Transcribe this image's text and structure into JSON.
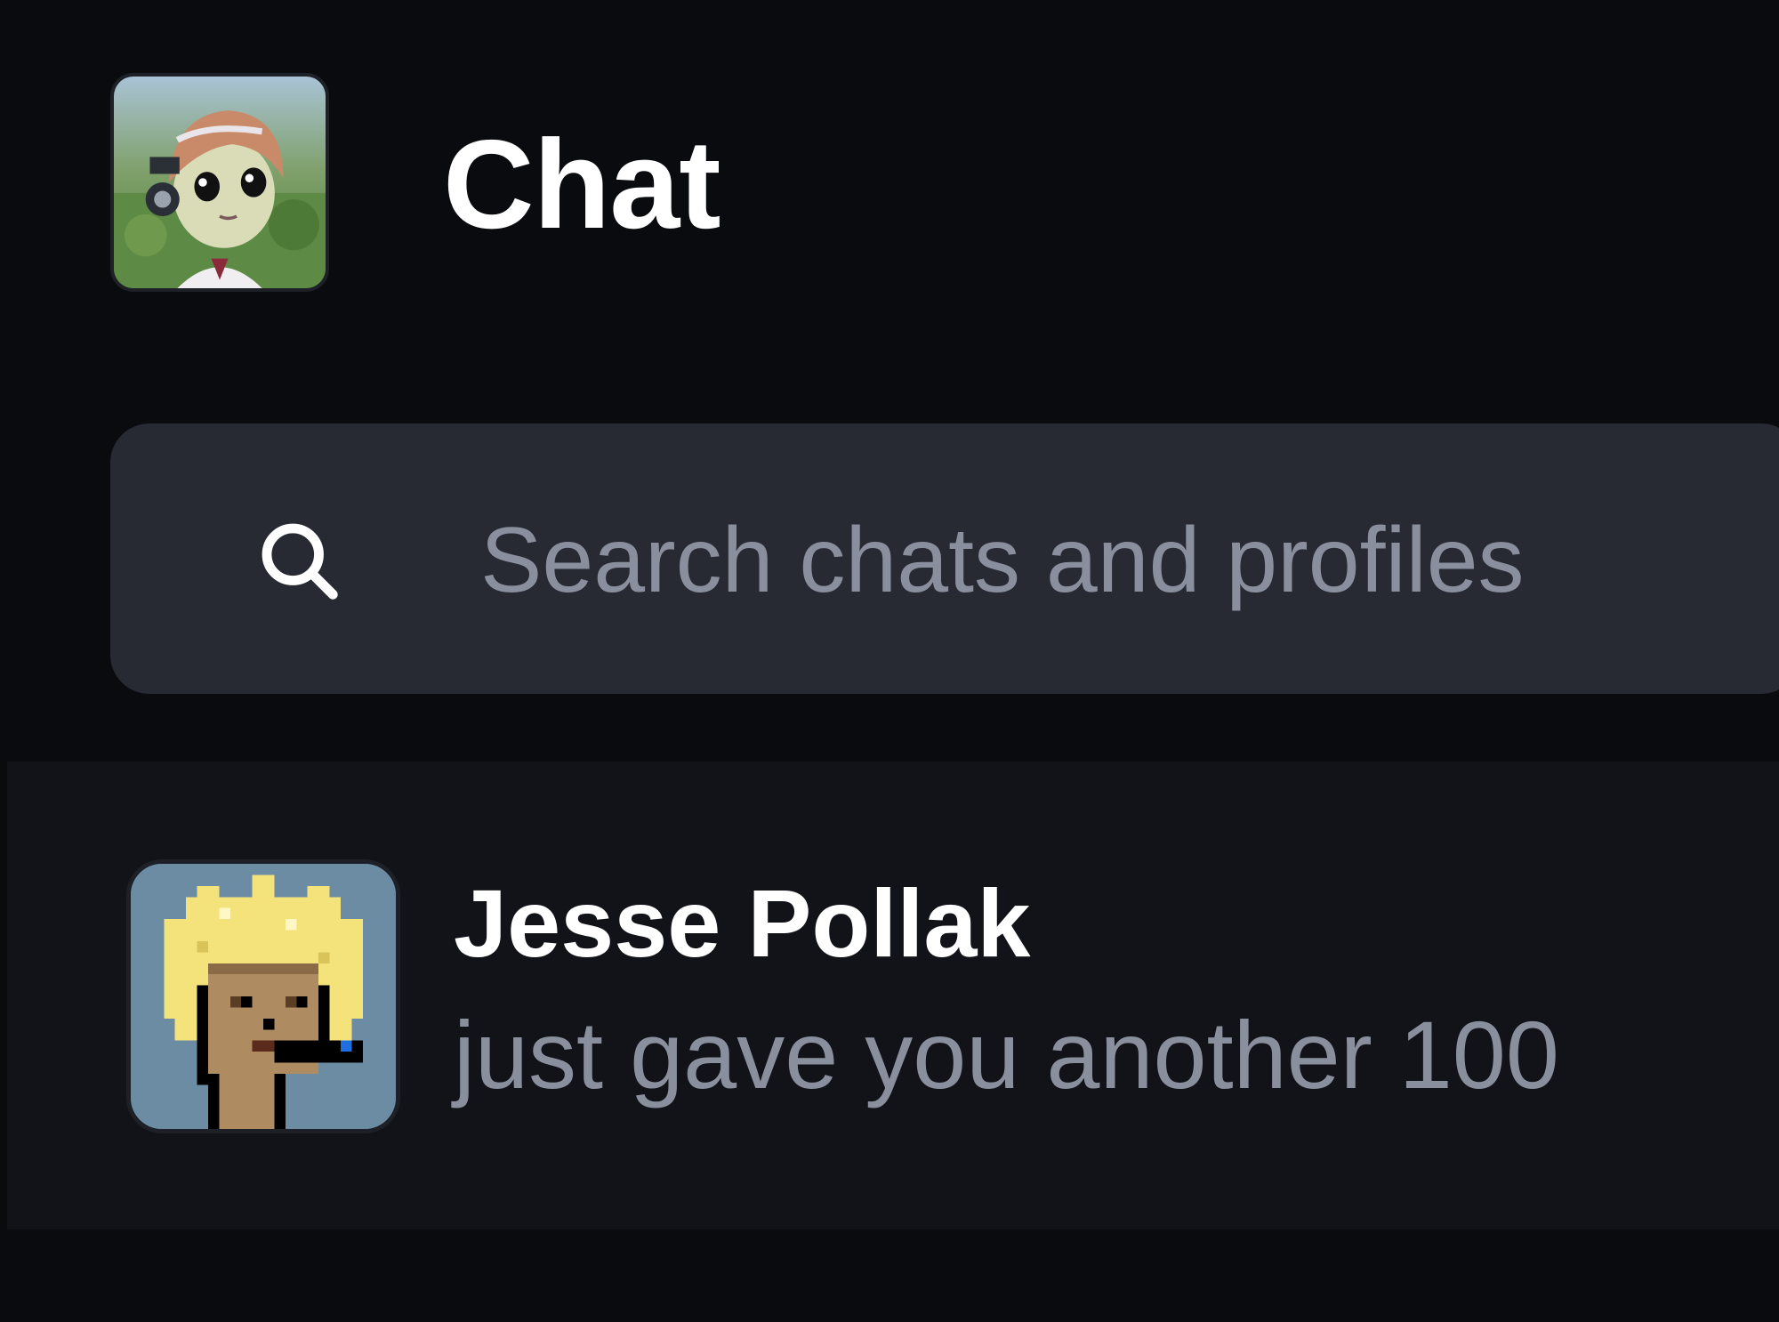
{
  "header": {
    "title": "Chat",
    "avatar_icon": "user-avatar-anime-icon"
  },
  "search": {
    "placeholder": "Search chats and profiles",
    "value": "",
    "icon": "search-icon"
  },
  "chats": [
    {
      "name": "Jesse Pollak",
      "preview": "just gave you another 100",
      "avatar_icon": "pixel-punk-avatar-icon"
    }
  ],
  "colors": {
    "background": "#0a0b0e",
    "search_bg": "#272a33",
    "list_bg": "#111318",
    "primary_text": "#ffffff",
    "secondary_text": "#8a8f9d"
  }
}
